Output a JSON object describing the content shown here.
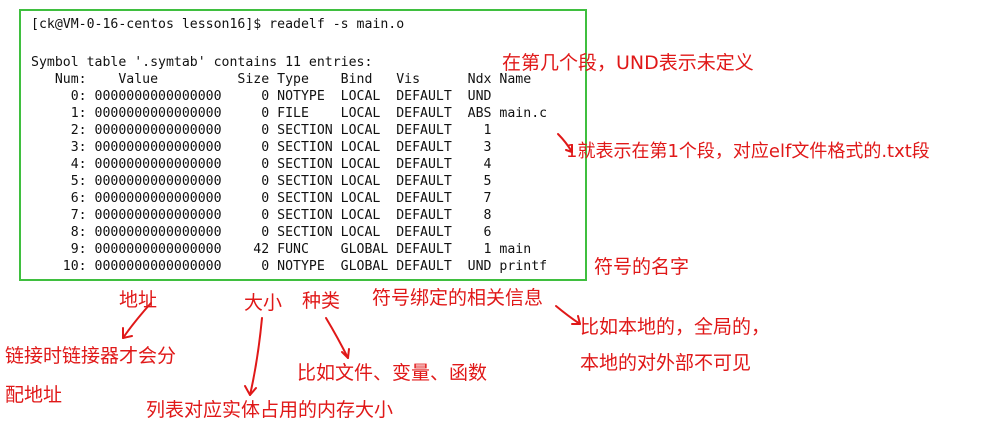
{
  "terminal": {
    "prompt": "[ck@VM-0-16-centos lesson16]$ readelf -s main.o",
    "symtab_header": "Symbol table '.symtab' contains 11 entries:",
    "columns_line": "   Num:    Value          Size Type    Bind   Vis      Ndx Name",
    "rows": [
      "     0: 0000000000000000     0 NOTYPE  LOCAL  DEFAULT  UND",
      "     1: 0000000000000000     0 FILE    LOCAL  DEFAULT  ABS main.c",
      "     2: 0000000000000000     0 SECTION LOCAL  DEFAULT    1",
      "     3: 0000000000000000     0 SECTION LOCAL  DEFAULT    3",
      "     4: 0000000000000000     0 SECTION LOCAL  DEFAULT    4",
      "     5: 0000000000000000     0 SECTION LOCAL  DEFAULT    5",
      "     6: 0000000000000000     0 SECTION LOCAL  DEFAULT    7",
      "     7: 0000000000000000     0 SECTION LOCAL  DEFAULT    8",
      "     8: 0000000000000000     0 SECTION LOCAL  DEFAULT    6",
      "     9: 0000000000000000    42 FUNC    GLOBAL DEFAULT    1 main",
      "    10: 0000000000000000     0 NOTYPE  GLOBAL DEFAULT  UND printf"
    ]
  },
  "annotations": {
    "ndx_meaning": "在第几个段，UND表示未定义",
    "ndx_example": "1就表示在第1个段，对应elf文件格式的.txt段",
    "name_meaning": "符号的名字",
    "address": "地址",
    "size": "大小",
    "type": "种类",
    "bind": "符号绑定的相关信息",
    "bind_example_line1": "比如本地的，全局的，",
    "bind_example_line2": "本地的对外部不可见",
    "address_example_line1": "链接时链接器才会分",
    "address_example_line2": "配地址",
    "type_example": "比如文件、变量、函数",
    "size_example": "列表对应实体占用的内存大小"
  },
  "colors": {
    "annotation": "#e01818",
    "terminal_border": "#3fbf3f",
    "terminal_text": "#111111"
  }
}
